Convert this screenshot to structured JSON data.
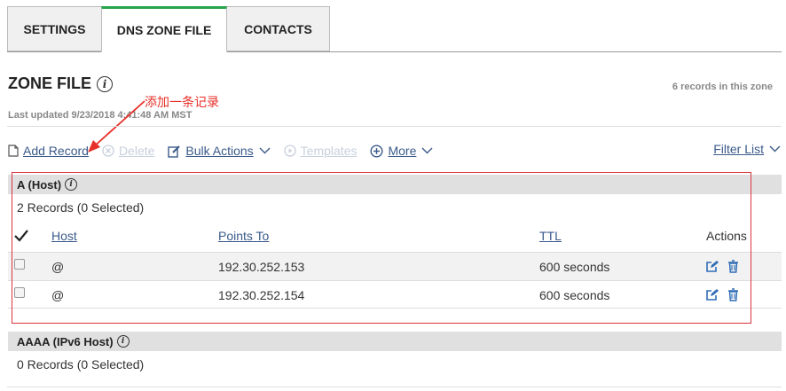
{
  "tabs": [
    {
      "label": "SETTINGS"
    },
    {
      "label": "DNS ZONE FILE"
    },
    {
      "label": "CONTACTS"
    }
  ],
  "zone": {
    "title": "ZONE FILE",
    "info_glyph": "i",
    "record_count": "6 records in this zone",
    "last_updated": "Last updated 9/23/2018 4:41:48 AM MST",
    "annotation": "添加一条记录",
    "annotation_color": "#e8302a"
  },
  "toolbar": {
    "add_record": "Add Record",
    "delete": "Delete",
    "bulk_actions": "Bulk Actions",
    "templates": "Templates",
    "more": "More",
    "filter_list": "Filter List"
  },
  "sections": [
    {
      "title": "A (Host)",
      "selected": "2 Records (0 Selected)",
      "columns": {
        "host": "Host",
        "points_to": "Points To",
        "ttl": "TTL",
        "actions": "Actions"
      },
      "rows": [
        {
          "host": "@",
          "points_to": "192.30.252.153",
          "ttl": "600 seconds"
        },
        {
          "host": "@",
          "points_to": "192.30.252.154",
          "ttl": "600 seconds"
        }
      ]
    },
    {
      "title": "AAAA (IPv6 Host)",
      "selected": "0 Records (0 Selected)"
    }
  ],
  "colors": {
    "link": "#3a5a8a",
    "active_tab_accent": "#27a54a",
    "action_icon": "#2f6db5"
  }
}
